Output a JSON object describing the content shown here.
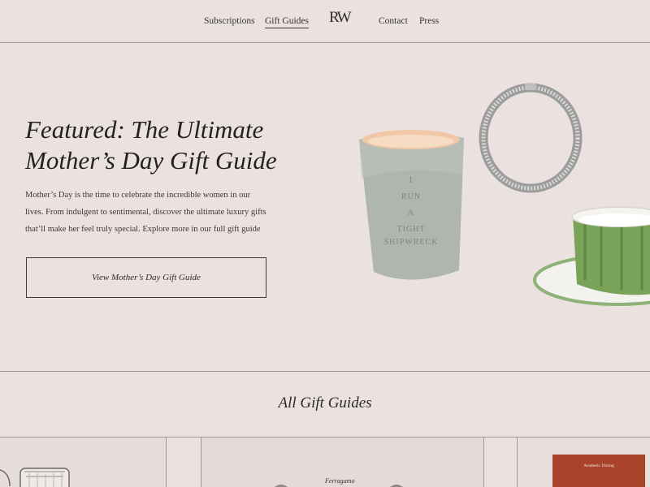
{
  "nav": {
    "left": [
      "Subscriptions",
      "Gift Guides"
    ],
    "right": [
      "Contact",
      "Press"
    ],
    "logo": "RW"
  },
  "hero": {
    "title_line1": "Featured: The Ultimate",
    "title_line2": "Mother’s Day Gift Guide",
    "body": "Mother’s Day is the time to celebrate the incredible women in our lives. From indulgent to sentimental, discover the ultimate luxury gifts that’ll make her feel truly special. Explore more in our full gift guide",
    "button": "View Mother’s Day Gift Guide",
    "candle_text": [
      "I",
      "RUN",
      "A",
      "TIGHT",
      "SHIPWRECK"
    ]
  },
  "section": {
    "title": "All Gift Guides"
  },
  "cards": {
    "card2_label": "Ferragamo",
    "card3_book_title": "Aesthetic Dining"
  },
  "colors": {
    "background": "#ebe2e0",
    "accent_green": "#7aa35a",
    "book_red": "#a9432a"
  }
}
